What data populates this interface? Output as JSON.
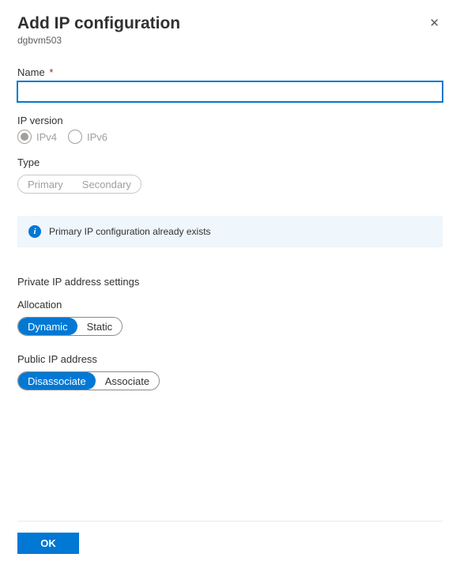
{
  "header": {
    "title": "Add IP configuration",
    "subtitle": "dgbvm503"
  },
  "fields": {
    "name": {
      "label": "Name",
      "value": "",
      "required_marker": "*"
    },
    "ip_version": {
      "label": "IP version",
      "options": {
        "ipv4": "IPv4",
        "ipv6": "IPv6"
      },
      "selected": "ipv4"
    },
    "type": {
      "label": "Type",
      "options": {
        "primary": "Primary",
        "secondary": "Secondary"
      }
    }
  },
  "banner": {
    "text": "Primary IP configuration already exists"
  },
  "private_ip": {
    "section_title": "Private IP address settings",
    "allocation": {
      "label": "Allocation",
      "options": {
        "dynamic": "Dynamic",
        "static": "Static"
      },
      "selected": "dynamic"
    }
  },
  "public_ip": {
    "label": "Public IP address",
    "options": {
      "disassociate": "Disassociate",
      "associate": "Associate"
    },
    "selected": "disassociate"
  },
  "footer": {
    "ok": "OK"
  }
}
